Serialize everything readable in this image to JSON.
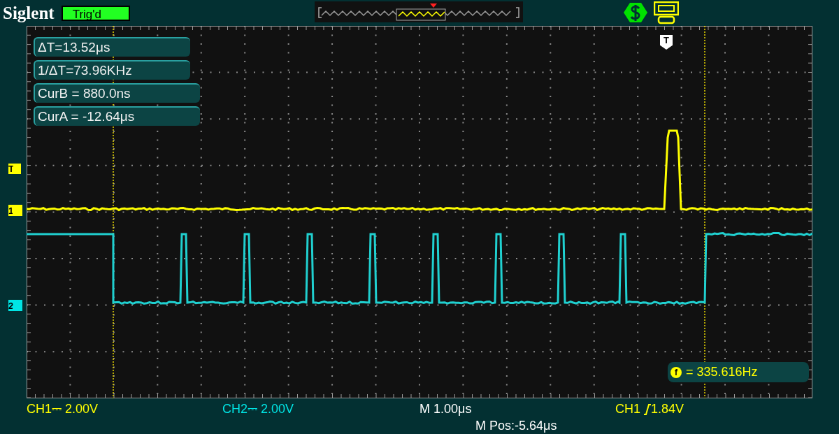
{
  "header": {
    "brand": "Siglent",
    "trigger_status": "Trig'd"
  },
  "cursor_readouts": [
    "ΔT=13.52μs",
    "1/ΔT=73.96KHz",
    "CurB = 880.0ns",
    "CurA = -12.64μs"
  ],
  "frequency": {
    "symbol": "f",
    "reading": "= 335.616Hz"
  },
  "markers": [
    {
      "label": "T",
      "color": "#ffff00",
      "kind": "trigger"
    },
    {
      "label": "1",
      "color": "#ffff00",
      "kind": "channel"
    },
    {
      "label": "2",
      "color": "#00e5e5",
      "kind": "channel"
    }
  ],
  "top_trigger_marker": "T",
  "status_bar": [
    {
      "text": "CH1⎓ 2.00V",
      "color": "#ffff00"
    },
    {
      "text": "CH2⎓ 2.00V",
      "color": "#00e5e5"
    },
    {
      "text": "M 1.00μs",
      "color": "#ffffff"
    }
  ],
  "trigger": {
    "source": "CH1",
    "level": "1.84V"
  },
  "position": "M Pos:-5.64μs"
}
